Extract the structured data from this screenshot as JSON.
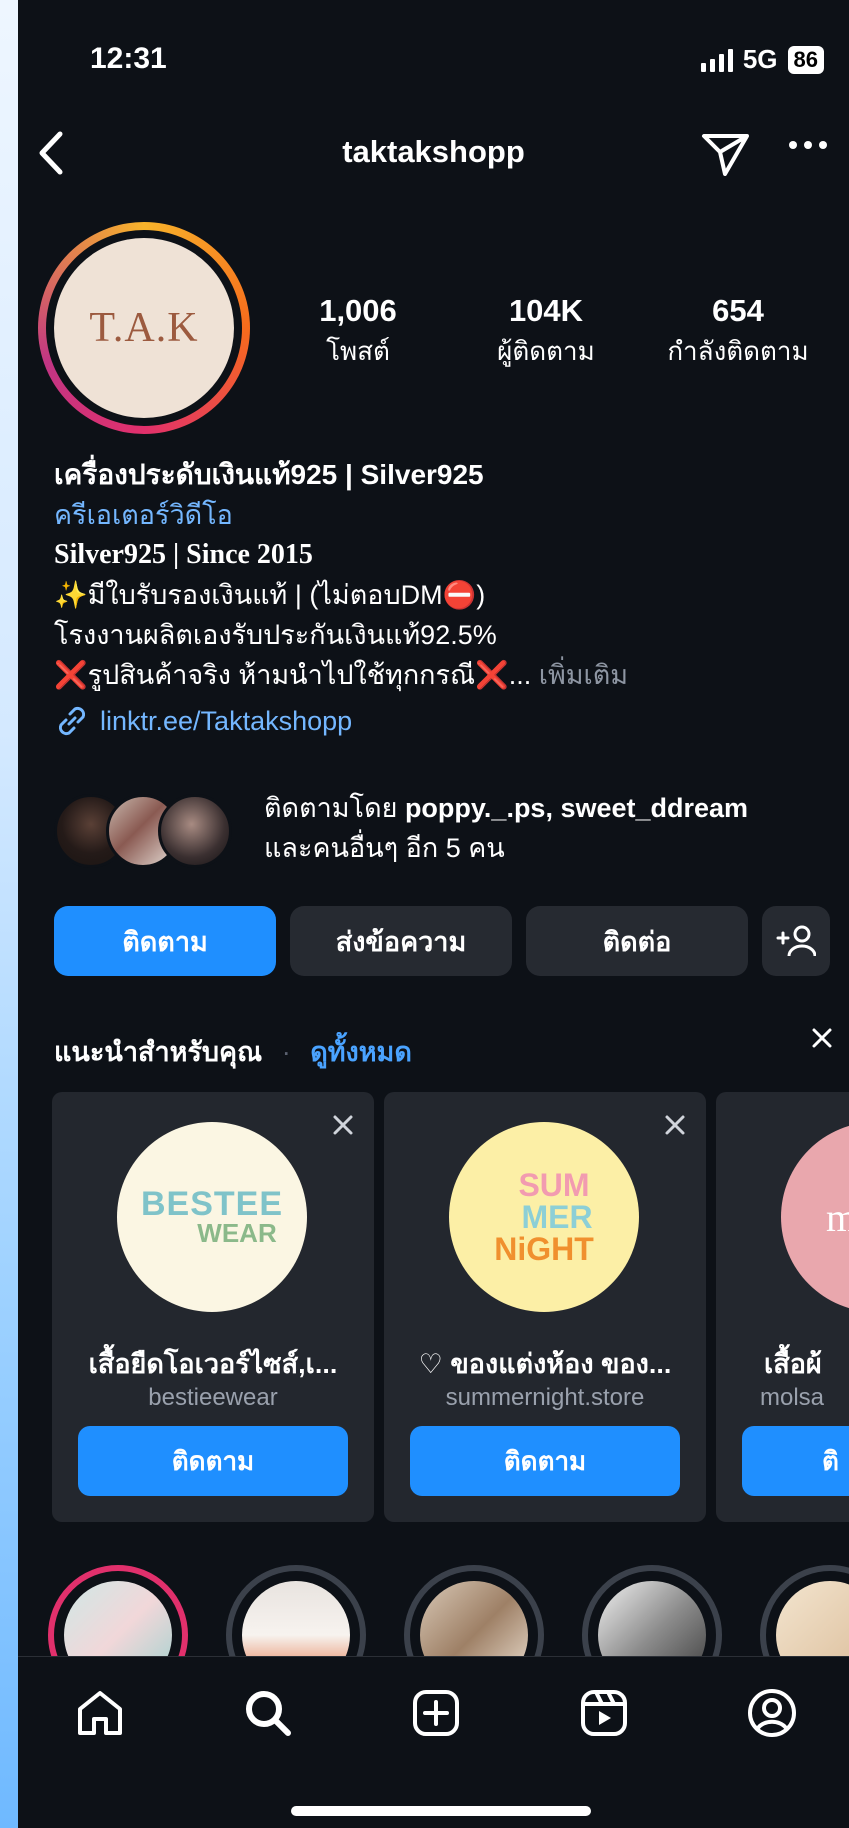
{
  "status_bar": {
    "time": "12:31",
    "network": "5G",
    "battery": "86"
  },
  "header": {
    "username": "taktakshopp"
  },
  "profile": {
    "avatar_text": "T.A.K",
    "stats": [
      {
        "value": "1,006",
        "label": "โพสต์"
      },
      {
        "value": "104K",
        "label": "ผู้ติดตาม"
      },
      {
        "value": "654",
        "label": "กำลังติดตาม"
      }
    ],
    "bio": {
      "name": "เครื่องประดับเงินแท้925 | Silver925",
      "category": "ครีเอเตอร์วิดีโอ",
      "line1": "Silver925 | Since 2015",
      "line2": "✨มีใบรับรองเงินแท้ | (ไม่ตอบDM⛔)",
      "line3": "โรงงานผลิตเองรับประกันเงินแท้92.5%",
      "line4": "❌รูปสินค้าจริง ห้ามนำไปใช้ทุกกรณี❌...",
      "more": "เพิ่มเติม",
      "link": "linktr.ee/Taktakshopp"
    },
    "followed_by": {
      "prefix": "ติดตามโดย",
      "names": "poppy._.ps, sweet_ddream",
      "others": "และคนอื่นๆ อีก 5 คน"
    }
  },
  "actions": {
    "follow": "ติดตาม",
    "message": "ส่งข้อความ",
    "contact": "ติดต่อ"
  },
  "suggestions": {
    "title": "แนะนำสำหรับคุณ",
    "see_all": "ดูทั้งหมด",
    "cards": [
      {
        "title": "เสื้อยืดโอเวอร์ไซส์,เ...",
        "username": "bestieewear",
        "button": "ติดตาม",
        "logo_text1": "BESTEE",
        "logo_text2": "WEAR"
      },
      {
        "title": "♡ ของแต่งห้อง ของ...",
        "username": "summernight.store",
        "button": "ติดตาม",
        "logo_text1": "SUM",
        "logo_text2": "MER",
        "logo_text3": "NiGHT"
      },
      {
        "title": "เสื้อผ้",
        "username": "molsa",
        "button": "ติ",
        "logo_text1": "m"
      }
    ]
  },
  "colors": {
    "background": "#0d1117",
    "primary_button": "#1f8fff",
    "secondary_button": "#262a31",
    "link": "#74b7ff"
  },
  "tab_bar": {
    "icons": [
      "home-icon",
      "search-icon",
      "add-icon",
      "reels-icon",
      "profile-icon"
    ]
  }
}
